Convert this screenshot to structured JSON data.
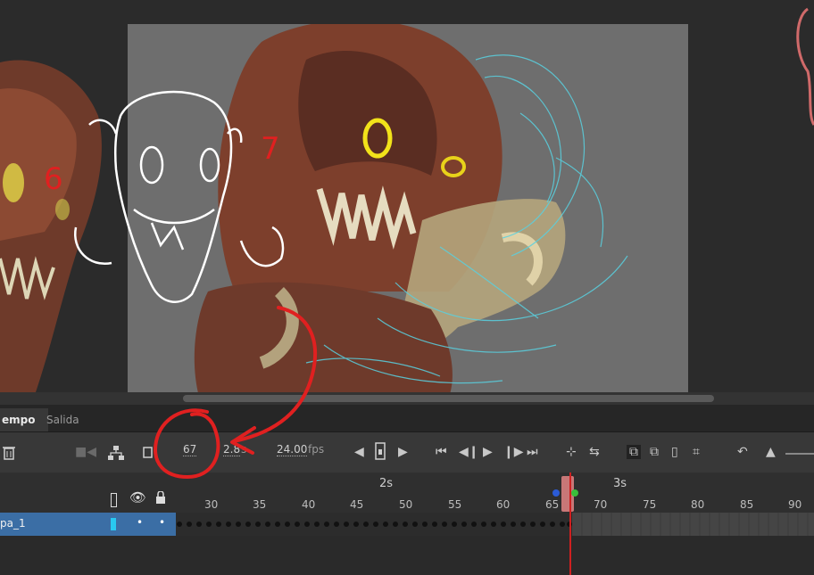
{
  "timeline_tabs": [
    "empo",
    "Salida"
  ],
  "toolbar": {
    "current_frame": "67",
    "time_value": "2.8",
    "time_unit": "s",
    "fps_value": "24.00",
    "fps_unit": "fps"
  },
  "ruler": {
    "seconds": [
      "2s",
      "3s"
    ],
    "ticks": [
      "30",
      "35",
      "40",
      "45",
      "50",
      "55",
      "60",
      "65",
      "70",
      "75",
      "80",
      "85",
      "90"
    ]
  },
  "layer": {
    "name": "pa_1"
  },
  "annotations": {
    "left_number": "6",
    "right_number": "7"
  },
  "colors": {
    "stage": "#6e6e6e",
    "layer_selected": "#3b6ea5",
    "playhead": "#cf2020",
    "annotation_red": "#e02020"
  }
}
